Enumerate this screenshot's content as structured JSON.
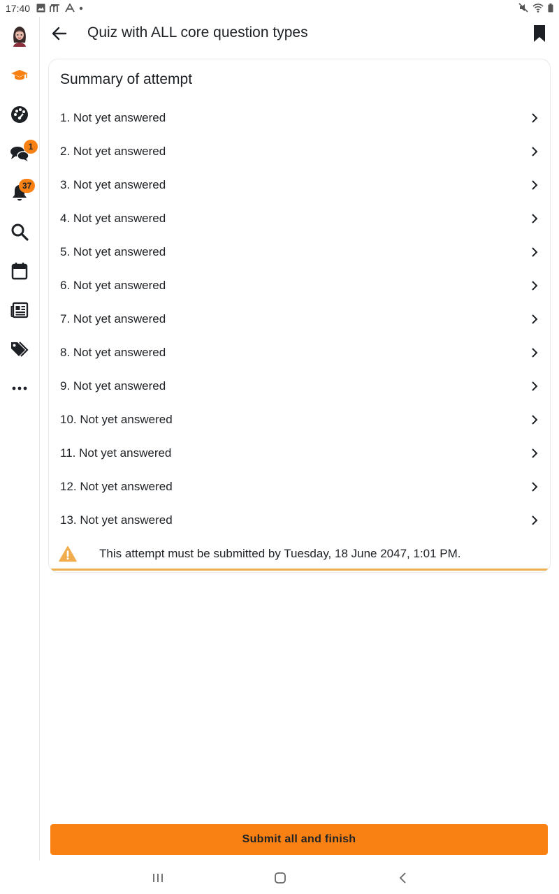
{
  "status_bar": {
    "time": "17:40"
  },
  "header": {
    "title": "Quiz with ALL core question types"
  },
  "rail": {
    "items": [
      {
        "icon": "avatar",
        "badge": ""
      },
      {
        "icon": "graduation-cap-icon",
        "badge": ""
      },
      {
        "icon": "dashboard-icon",
        "badge": ""
      },
      {
        "icon": "messages-icon",
        "badge": "1"
      },
      {
        "icon": "bell-icon",
        "badge": "37"
      },
      {
        "icon": "search-icon",
        "badge": ""
      },
      {
        "icon": "calendar-icon",
        "badge": ""
      },
      {
        "icon": "news-icon",
        "badge": ""
      },
      {
        "icon": "tags-icon",
        "badge": ""
      },
      {
        "icon": "more-icon",
        "badge": ""
      }
    ]
  },
  "summary": {
    "title": "Summary of attempt",
    "questions": [
      "1. Not yet answered",
      "2. Not yet answered",
      "3. Not yet answered",
      "4. Not yet answered",
      "5. Not yet answered",
      "6. Not yet answered",
      "7. Not yet answered",
      "8. Not yet answered",
      "9. Not yet answered",
      "10. Not yet answered",
      "11. Not yet answered",
      "12. Not yet answered",
      "13. Not yet answered"
    ],
    "warning": "This attempt must be submitted by Tuesday, 18 June 2047, 1:01 PM."
  },
  "actions": {
    "submit_label": "Submit all and finish"
  },
  "colors": {
    "accent": "#f98012",
    "warning": "#f0ad4e",
    "text": "#1d2125"
  }
}
